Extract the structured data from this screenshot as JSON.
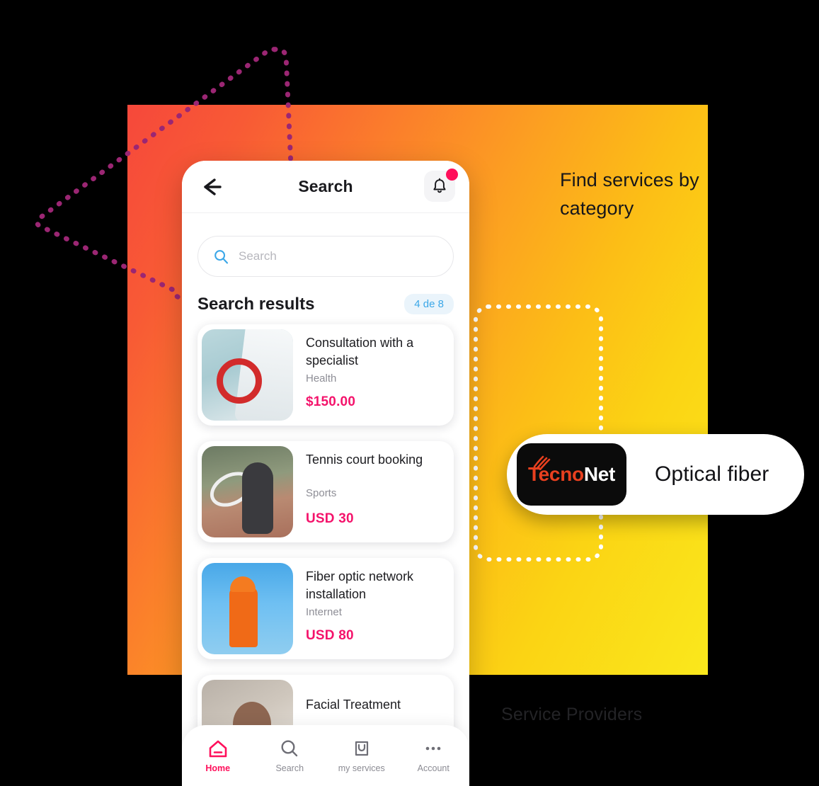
{
  "canvas": {
    "background": "#000000"
  },
  "gradient_panel": {
    "from": "#F6483B",
    "mid": "#FCA021",
    "to": "#FAE81C"
  },
  "annotations": {
    "headline": "Find services by category",
    "providers_label": "Service Providers",
    "triangle_color": "#9B2673",
    "connector_color": "#FFFFFF"
  },
  "callout_pill": {
    "logo_part1": "Tecno",
    "logo_part2": "Net",
    "logo_color_1": "#E8401F",
    "logo_color_2": "#FFFFFF",
    "label": "Optical fiber"
  },
  "phone": {
    "header": {
      "title": "Search",
      "back_icon": "arrow-left-icon",
      "bell_icon": "bell-icon",
      "has_notification": true,
      "notification_color": "#FF0F5B"
    },
    "search": {
      "placeholder": "Search",
      "value": "",
      "icon": "search-icon",
      "icon_color": "#3BA7E8"
    },
    "results": {
      "title": "Search results",
      "badge": "4 de 8",
      "badge_color": "#3BA7E8",
      "items": [
        {
          "title": "Consultation with a specialist",
          "category": "Health",
          "price": "$150.00",
          "thumb": "doctor-stethoscope-photo"
        },
        {
          "title": "Tennis court booking",
          "category": "Sports",
          "price": "USD 30",
          "thumb": "tennis-player-photo"
        },
        {
          "title": "Fiber optic network installation",
          "category": "Internet",
          "price": "USD 80",
          "thumb": "lineman-utility-pole-photo"
        },
        {
          "title": "Facial Treatment",
          "category": "",
          "price": "",
          "thumb": "facial-treatment-photo"
        }
      ],
      "price_color": "#F4136B"
    },
    "bottom_nav": {
      "active_color": "#FF0F5B",
      "items": [
        {
          "label": "Home",
          "icon": "home-icon",
          "active": true
        },
        {
          "label": "Search",
          "icon": "search-icon",
          "active": false
        },
        {
          "label": "my services",
          "icon": "bag-icon",
          "active": false
        },
        {
          "label": "Account",
          "icon": "ellipsis-icon",
          "active": false
        }
      ]
    }
  }
}
